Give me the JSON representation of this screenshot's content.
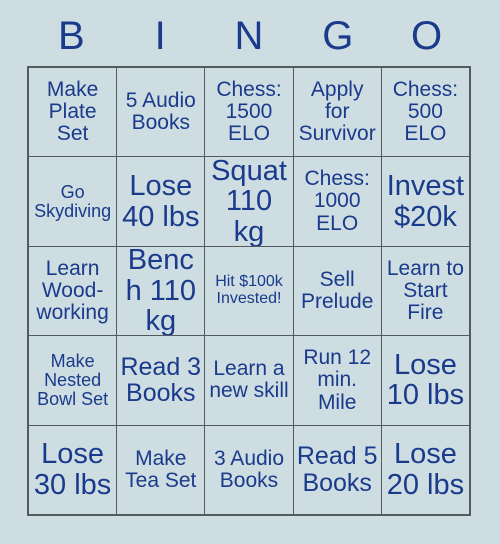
{
  "card": {
    "title": "BINGO Card",
    "header_letters": [
      "B",
      "I",
      "N",
      "G",
      "O"
    ],
    "colors": {
      "background": "#cddde1",
      "text": "#1a3a8c",
      "border": "#555a5c"
    },
    "grid": {
      "columns": 5,
      "rows": 5,
      "cells": [
        {
          "text": "Make Plate Set",
          "size": "md"
        },
        {
          "text": "5 Audio Books",
          "size": "md"
        },
        {
          "text": "Chess: 1500 ELO",
          "size": "md"
        },
        {
          "text": "Apply for Survivor",
          "size": "md"
        },
        {
          "text": "Chess: 500 ELO",
          "size": "md"
        },
        {
          "text": "Go Skydiving",
          "size": "sm"
        },
        {
          "text": "Lose 40 lbs",
          "size": "xl"
        },
        {
          "text": "Squat 110 kg",
          "size": "xl"
        },
        {
          "text": "Chess: 1000 ELO",
          "size": "md"
        },
        {
          "text": "Invest $20k",
          "size": "xl"
        },
        {
          "text": "Learn Wood-working",
          "size": "md"
        },
        {
          "text": "Bench 110 kg",
          "size": "xl"
        },
        {
          "text": "Hit $100k Invested!",
          "size": "xs"
        },
        {
          "text": "Sell Prelude",
          "size": "md"
        },
        {
          "text": "Learn to Start Fire",
          "size": "md"
        },
        {
          "text": "Make Nested Bowl Set",
          "size": "sm"
        },
        {
          "text": "Read 3 Books",
          "size": "lg"
        },
        {
          "text": "Learn a new skill",
          "size": "md"
        },
        {
          "text": "Run 12 min. Mile",
          "size": "md"
        },
        {
          "text": "Lose 10 lbs",
          "size": "xl"
        },
        {
          "text": "Lose 30 lbs",
          "size": "xl"
        },
        {
          "text": "Make Tea Set",
          "size": "md"
        },
        {
          "text": "3 Audio Books",
          "size": "md"
        },
        {
          "text": "Read 5 Books",
          "size": "lg"
        },
        {
          "text": "Lose 20 lbs",
          "size": "xl"
        }
      ]
    }
  }
}
